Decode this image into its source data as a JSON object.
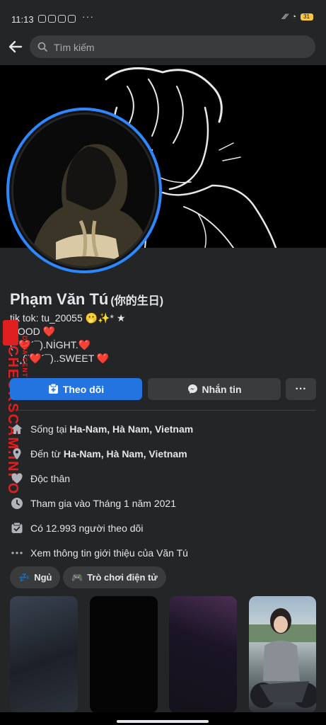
{
  "status_bar": {
    "time": "11:13",
    "battery": "31"
  },
  "search": {
    "placeholder": "Tìm kiếm"
  },
  "profile": {
    "name": "Phạm Văn Tú",
    "alternate_name": "(你的生日)",
    "bio_lines": [
      "tik tok: tu_20055 🫢✨* ★",
      "GOOD ❤️",
      "(¯❤️´¯).NİGHT.❤️",
      "`·.¸(¨❤️´¯)..SWEET ❤️"
    ]
  },
  "buttons": {
    "follow": "Theo dõi",
    "message": "Nhắn tin",
    "more": "···"
  },
  "info": {
    "lives_prefix": "Sống tại",
    "lives_place": "Ha-Nam, Hà Nam, Vietnam",
    "from_prefix": "Đến từ",
    "from_place": "Ha-Nam, Hà Nam, Vietnam",
    "relationship": "Độc thân",
    "joined": "Tham gia vào Tháng 1 năm 2021",
    "followers": "Có 12.993 người theo dõi",
    "see_about": "Xem thông tin giới thiệu của Văn Tú"
  },
  "chips": [
    {
      "label": "Ngủ",
      "icon": "💤"
    },
    {
      "label": "Trò chơi điện tử",
      "icon": "🎮"
    }
  ],
  "watermark": {
    "main": "CHECKSCAM.INFO",
    "sub": "DATA CENTER"
  },
  "colors": {
    "accent": "#2374e1",
    "background": "#242526",
    "surface": "#3a3b3c",
    "avatar_ring": "#2d88ff",
    "watermark": "#e02020"
  }
}
